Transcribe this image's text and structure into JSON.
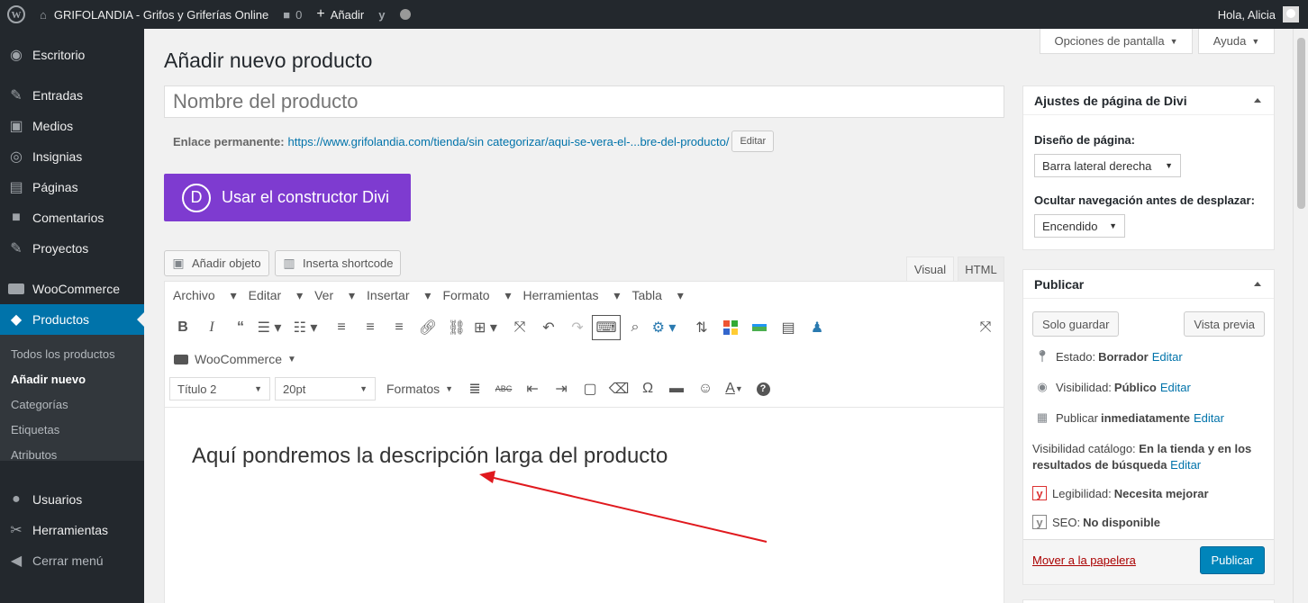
{
  "adminbar": {
    "wp_icon": "wordpress-icon",
    "site_name": "GRIFOLANDIA - Grifos y Griferías Online",
    "comments_count": "0",
    "add_new": "Añadir",
    "greeting": "Hola, Alicia"
  },
  "sidebar": {
    "items": [
      {
        "label": "Escritorio",
        "icon": "dashboard-icon"
      },
      {
        "label": "Entradas",
        "icon": "pin-icon"
      },
      {
        "label": "Medios",
        "icon": "media-icon"
      },
      {
        "label": "Insignias",
        "icon": "eye-icon"
      },
      {
        "label": "Páginas",
        "icon": "page-icon"
      },
      {
        "label": "Comentarios",
        "icon": "comment-icon"
      },
      {
        "label": "Proyectos",
        "icon": "pin-icon"
      },
      {
        "label": "WooCommerce",
        "icon": "woocommerce-icon"
      },
      {
        "label": "Productos",
        "icon": "box-icon"
      },
      {
        "label": "Usuarios",
        "icon": "user-icon"
      },
      {
        "label": "Herramientas",
        "icon": "wrench-icon"
      },
      {
        "label": "Cerrar menú",
        "icon": "collapse-icon"
      }
    ],
    "submenu": [
      "Todos los productos",
      "Añadir nuevo",
      "Categorías",
      "Etiquetas",
      "Atributos"
    ]
  },
  "screen_options": "Opciones de pantalla",
  "help": "Ayuda",
  "page_title": "Añadir nuevo producto",
  "title_placeholder": "Nombre del producto",
  "permalink": {
    "label": "Enlace permanente:",
    "url": "https://www.grifolandia.com/tienda/sin categorizar/aqui-se-vera-el-...bre-del-producto/",
    "edit": "Editar"
  },
  "divi_button": {
    "letter": "D",
    "label": "Usar el constructor Divi"
  },
  "media_buttons": {
    "add_object": "Añadir objeto",
    "shortcode": "Inserta shortcode"
  },
  "editor_tabs": {
    "visual": "Visual",
    "html": "HTML"
  },
  "menubar": [
    "Archivo",
    "Editar",
    "Ver",
    "Insertar",
    "Formato",
    "Herramientas",
    "Tabla"
  ],
  "toolbar": {
    "woocommerce": "WooCommerce",
    "heading": "Título 2",
    "font_size": "20pt",
    "formats": "Formatos"
  },
  "content_text": "Aquí pondremos la descripción larga del producto",
  "divi_settings": {
    "title": "Ajustes de página de Divi",
    "layout_label": "Diseño de página:",
    "layout_value": "Barra lateral derecha",
    "nav_label": "Ocultar navegación antes de desplazar:",
    "nav_value": "Encendido"
  },
  "publish": {
    "title": "Publicar",
    "save_draft": "Solo guardar",
    "preview": "Vista previa",
    "status_label": "Estado:",
    "status_value": "Borrador",
    "visibility_label": "Visibilidad:",
    "visibility_value": "Público",
    "publish_label": "Publicar",
    "publish_value": "inmediatamente",
    "catalog_label": "Visibilidad catálogo:",
    "catalog_value": "En la tienda y en los resultados de búsqueda",
    "readability_label": "Legibilidad:",
    "readability_value": "Necesita mejorar",
    "seo_label": "SEO:",
    "seo_value": "No disponible",
    "edit": "Editar",
    "trash": "Mover a la papelera",
    "publish_button": "Publicar"
  },
  "colors": {
    "accent": "#0073aa",
    "divi": "#7e3bd0",
    "admin_bar": "#23282d",
    "arrow": "#e0191e"
  }
}
